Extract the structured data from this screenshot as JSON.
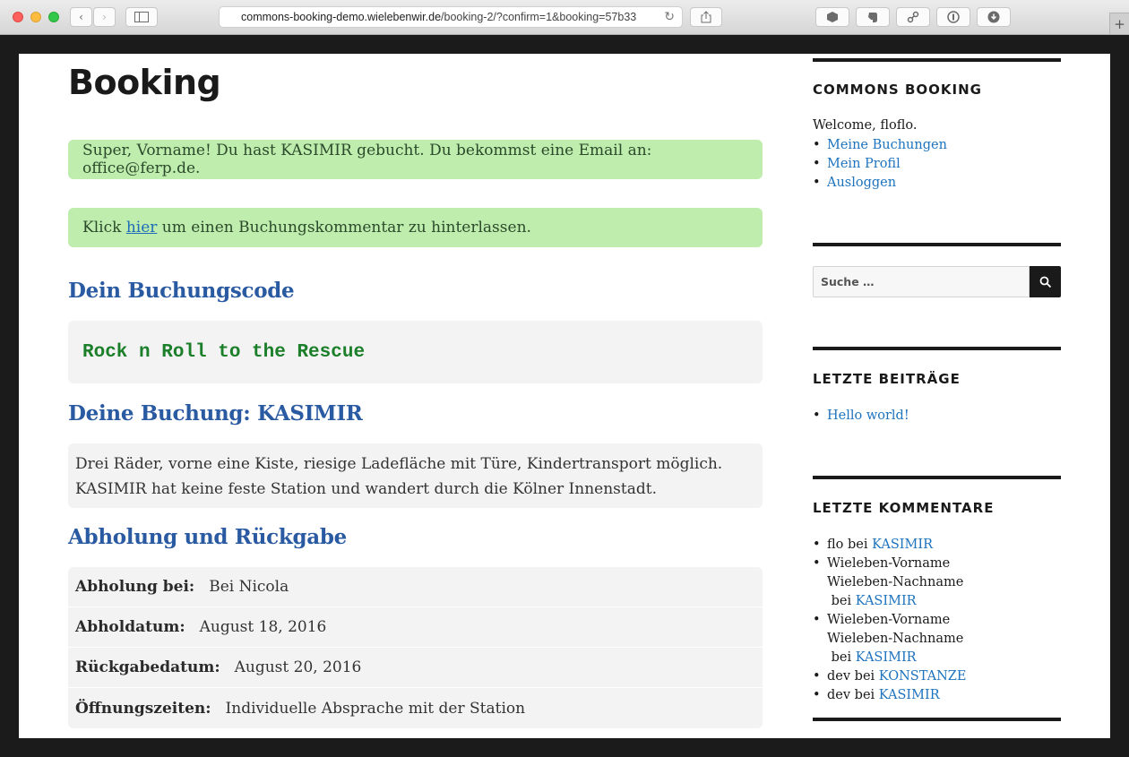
{
  "browser": {
    "url_host": "commons-booking-demo.wielebenwir.de",
    "url_path": "/booking-2/?confirm=1&booking=57b33",
    "new_tab": "+"
  },
  "page": {
    "title": "Booking",
    "success_notice": "Super, Vorname! Du hast KASIMIR gebucht. Du bekommst eine Email an: office@ferp.de.",
    "comment_notice": {
      "before": "Klick ",
      "link": "hier",
      "after": " um einen Buchungskommentar zu hinterlassen."
    },
    "code_heading": "Dein Buchungscode",
    "booking_code": "Rock n Roll to the Rescue",
    "item_heading": "Deine Buchung: KASIMIR",
    "item_description": "Drei Räder, vorne eine Kiste, riesige Ladefläche mit Türe, Kindertransport möglich. KASIMIR hat keine feste Station und wandert durch die Kölner Innenstadt.",
    "pickup_heading": "Abholung und Rückgabe",
    "details": [
      {
        "label": "Abholung bei:",
        "value": "Bei Nicola"
      },
      {
        "label": "Abholdatum:",
        "value": "August 18, 2016"
      },
      {
        "label": "Rückgabedatum:",
        "value": "August 20, 2016"
      },
      {
        "label": "Öffnungszeiten:",
        "value": "Individuelle Absprache mit der Station"
      }
    ]
  },
  "sidebar": {
    "cb_heading": "COMMONS BOOKING",
    "welcome": "Welcome, floflo.",
    "user_links": [
      "Meine Buchungen",
      "Mein Profil",
      "Ausloggen"
    ],
    "search_placeholder": "Suche …",
    "recent_posts_heading": "LETZTE BEITRÄGE",
    "recent_posts": [
      "Hello world!"
    ],
    "recent_comments_heading": "LETZTE KOMMENTARE",
    "recent_comments": [
      {
        "author": "flo",
        "sep": " bei ",
        "post": "KASIMIR"
      },
      {
        "author": "Wieleben-Vorname Wieleben-Nachname",
        "sep": " bei ",
        "post": "KASIMIR"
      },
      {
        "author": "Wieleben-Vorname Wieleben-Nachname",
        "sep": " bei ",
        "post": "KASIMIR"
      },
      {
        "author": "dev",
        "sep": " bei ",
        "post": "KONSTANZE"
      },
      {
        "author": "dev",
        "sep": " bei ",
        "post": "KASIMIR"
      }
    ]
  },
  "colors": {
    "notice_bg": "#bfedad",
    "heading_blue": "#2a5aa1",
    "code_green": "#1b7f2a",
    "link_blue": "#1e73be"
  }
}
